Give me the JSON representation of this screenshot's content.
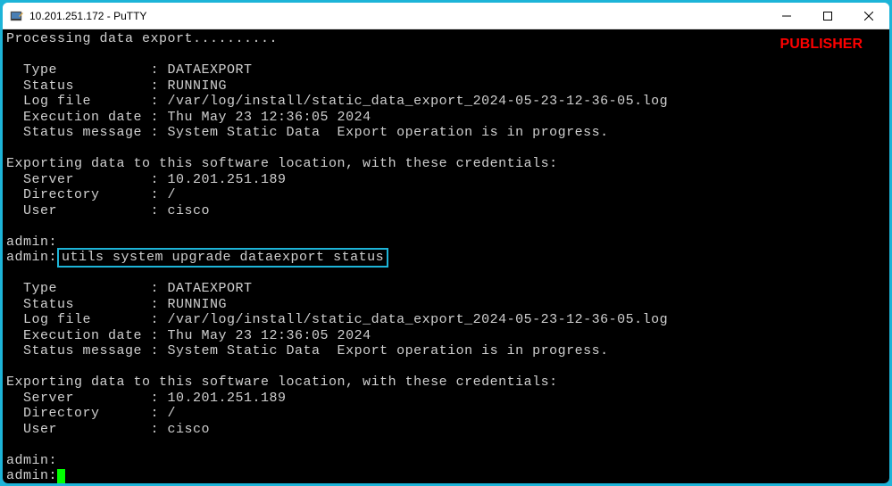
{
  "window": {
    "title": "10.201.251.172 - PuTTY",
    "publisher": "PUBLISHER"
  },
  "terminal": {
    "processing": "Processing data export..........",
    "block1": {
      "type_label": "  Type           :",
      "type_value": " DATAEXPORT",
      "status_label": "  Status         :",
      "status_value": " RUNNING",
      "log_label": "  Log file       :",
      "log_value": " /var/log/install/static_data_export_2024-05-23-12-36-05.log",
      "exec_label": "  Execution date :",
      "exec_value": " Thu May 23 12:36:05 2024",
      "msg_label": "  Status message :",
      "msg_value": " System Static Data  Export operation is in progress."
    },
    "export_header": "Exporting data to this software location, with these credentials:",
    "export1": {
      "server_label": "  Server         :",
      "server_value": " 10.201.251.189",
      "dir_label": "  Directory      :",
      "dir_value": " /",
      "user_label": "  User           :",
      "user_value": " cisco"
    },
    "admin_prompt": "admin:",
    "cmd_prompt": "admin:",
    "cmd": "utils system upgrade dataexport status",
    "block2": {
      "type_label": "  Type           :",
      "type_value": " DATAEXPORT",
      "status_label": "  Status         :",
      "status_value": " RUNNING",
      "log_label": "  Log file       :",
      "log_value": " /var/log/install/static_data_export_2024-05-23-12-36-05.log",
      "exec_label": "  Execution date :",
      "exec_value": " Thu May 23 12:36:05 2024",
      "msg_label": "  Status message :",
      "msg_value": " System Static Data  Export operation is in progress."
    },
    "export2": {
      "server_label": "  Server         :",
      "server_value": " 10.201.251.189",
      "dir_label": "  Directory      :",
      "dir_value": " /",
      "user_label": "  User           :",
      "user_value": " cisco"
    }
  }
}
